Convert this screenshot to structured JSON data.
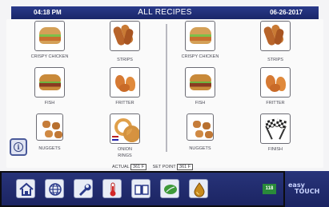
{
  "header": {
    "time": "04:18 PM",
    "title": "ALL RECIPES",
    "date": "06-26-2017"
  },
  "left_recipes": [
    {
      "label": "CRISPY CHICKEN",
      "icon": "crispy-chicken-icon"
    },
    {
      "label": "STRIPS",
      "icon": "strips-icon"
    },
    {
      "label": "FISH",
      "icon": "fish-icon"
    },
    {
      "label": "FRITTER",
      "icon": "fritter-icon"
    },
    {
      "label": "NUGGETS",
      "icon": "nuggets-icon"
    },
    {
      "label": "ONION RINGS",
      "icon": "onion-rings-icon"
    }
  ],
  "right_recipes": [
    {
      "label": "CRISPY CHICKEN",
      "icon": "crispy-chicken-icon"
    },
    {
      "label": "STRIPS",
      "icon": "strips-icon"
    },
    {
      "label": "FISH",
      "icon": "fish-icon"
    },
    {
      "label": "FRITTER",
      "icon": "fritter-icon"
    },
    {
      "label": "NUGGETS",
      "icon": "nuggets-icon"
    },
    {
      "label": "FINISH",
      "icon": "finish-flags-icon"
    }
  ],
  "status": {
    "actual_label": "ACTUAL",
    "actual_value": "361 F",
    "set_point_label": "SET POINT",
    "set_point_value": "361 F"
  },
  "toolbar": {
    "buttons": [
      "home-icon",
      "globe-icon",
      "settings-icon",
      "thermometer-icon",
      "book-icon",
      "leaf-icon",
      "oil-drop-icon"
    ],
    "temp_badge": "118"
  },
  "brand": {
    "line1": "easy",
    "line2": "TOUCH"
  },
  "colors": {
    "header": "#1a2668",
    "toolbar": "#1b2462",
    "badge": "#2a8a3a"
  }
}
